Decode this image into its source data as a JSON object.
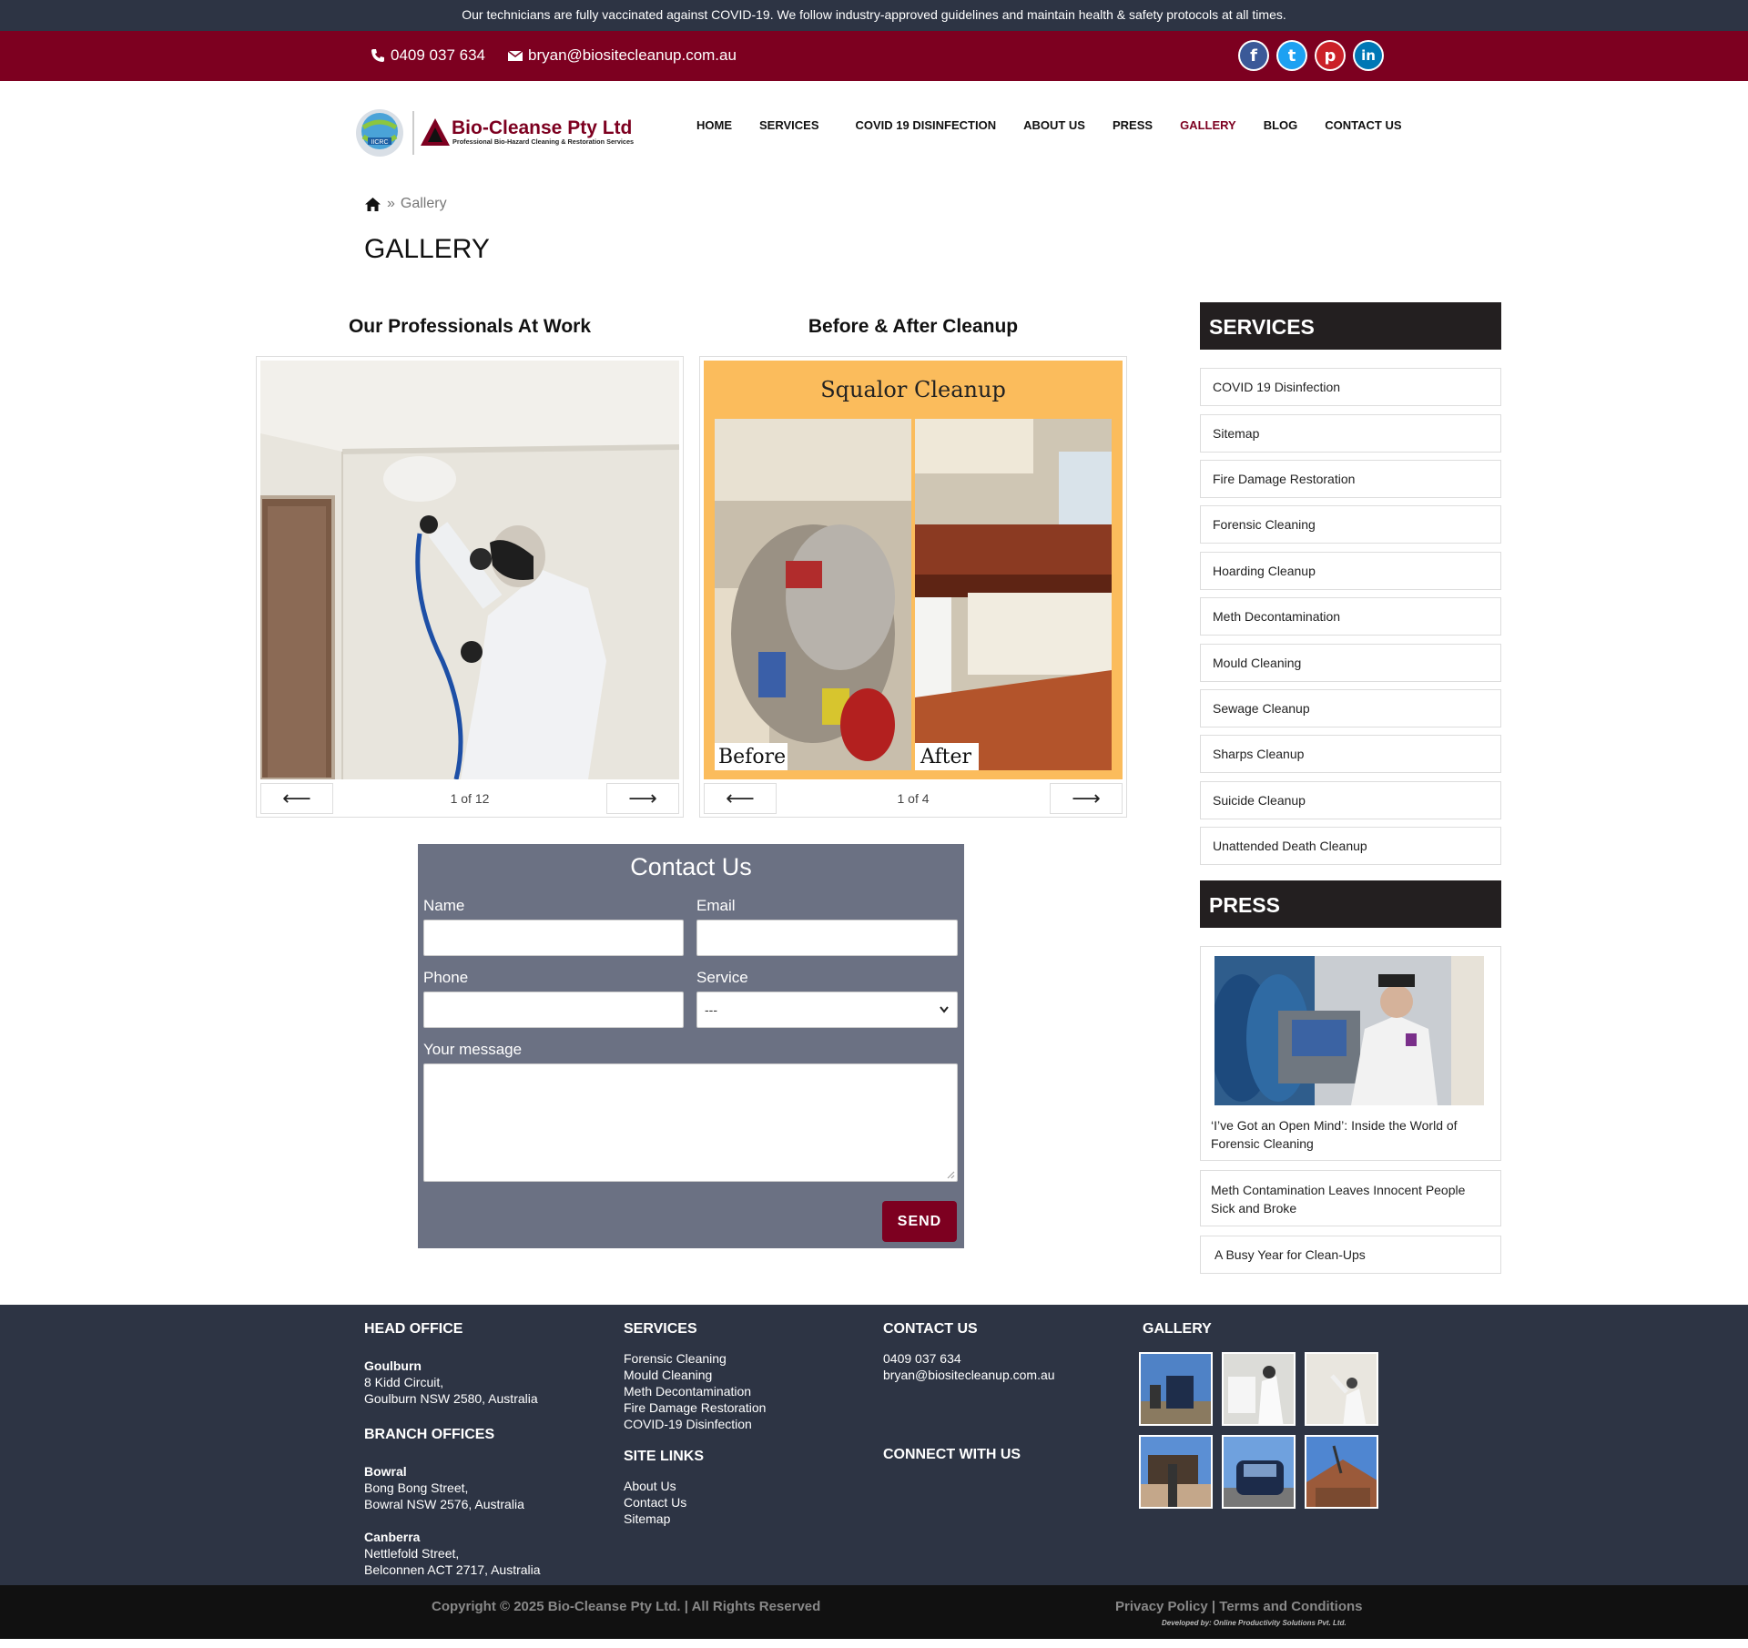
{
  "notice": "Our technicians are fully vaccinated against COVID-19. We follow industry-approved guidelines and maintain health & safety protocols at all times.",
  "contact_bar": {
    "phone": "0409 037 634",
    "email": "bryan@biositecleanup.com.au"
  },
  "socials": [
    {
      "name": "facebook-icon",
      "glyph": "f",
      "color": "#3b5998"
    },
    {
      "name": "twitter-icon",
      "glyph": "t",
      "color": "#1da1f2"
    },
    {
      "name": "pinterest-icon",
      "glyph": "p",
      "color": "#cb2027"
    },
    {
      "name": "linkedin-icon",
      "glyph": "in",
      "color": "#0077b5"
    }
  ],
  "logo": {
    "name": "Bio-Cleanse Pty Ltd",
    "tagline": "Professional Bio-Hazard Cleaning & Restoration Services",
    "badge": "IICRC"
  },
  "nav": [
    "HOME",
    "SERVICES",
    "COVID 19 DISINFECTION",
    "ABOUT US",
    "PRESS",
    "GALLERY",
    "BLOG",
    "CONTACT US"
  ],
  "breadcrumb": {
    "separator": "»",
    "current": "Gallery"
  },
  "page_title": "GALLERY",
  "galleries": [
    {
      "title": "Our Professionals At Work",
      "counter": "1 of 12",
      "prev": "⟵",
      "next": "⟶"
    },
    {
      "title": "Before & After Cleanup",
      "counter": "1 of 4",
      "prev": "⟵",
      "next": "⟶",
      "image_title": "Squalor Cleanup",
      "before_label": "Before",
      "after_label": "After"
    }
  ],
  "contact_form": {
    "title": "Contact Us",
    "name_label": "Name",
    "email_label": "Email",
    "phone_label": "Phone",
    "service_label": "Service",
    "service_value": "---",
    "message_label": "Your message",
    "send_label": "SEND"
  },
  "sidebar": {
    "services_title": "SERVICES",
    "services": [
      "COVID 19 Disinfection",
      "Sitemap",
      "Fire Damage Restoration",
      "Forensic Cleaning",
      "Hoarding Cleanup",
      "Meth Decontamination",
      "Mould Cleaning",
      "Sewage Cleanup",
      "Sharps Cleanup",
      "Suicide Cleanup",
      "Unattended Death Cleanup"
    ],
    "press_title": "PRESS",
    "press": [
      "‘I’ve Got an Open Mind’: Inside the World of Forensic Cleaning",
      "Meth Contamination Leaves Innocent People Sick and Broke",
      "A Busy Year for Clean-Ups"
    ]
  },
  "footer": {
    "head_office_title": "HEAD OFFICE",
    "head_office": {
      "city": "Goulburn",
      "line1": "8 Kidd Circuit,",
      "line2": "Goulburn NSW 2580, Australia"
    },
    "branch_title": "BRANCH OFFICES",
    "branches": [
      {
        "city": "Bowral",
        "line1": "Bong Bong Street,",
        "line2": "Bowral NSW 2576, Australia"
      },
      {
        "city": "Canberra",
        "line1": "Nettlefold Street,",
        "line2": "Belconnen ACT 2717, Australia"
      }
    ],
    "services_title": "SERVICES",
    "services": [
      "Forensic Cleaning",
      "Mould Cleaning",
      "Meth Decontamination",
      "Fire Damage Restoration",
      "COVID-19 Disinfection"
    ],
    "site_links_title": "SITE LINKS",
    "site_links": [
      "About Us",
      "Contact Us",
      "Sitemap"
    ],
    "contact_title": "CONTACT US",
    "phone": "0409 037 634",
    "email": "bryan@biositecleanup.com.au",
    "connect_title": "CONNECT WITH US",
    "gallery_title": "GALLERY"
  },
  "bottom": {
    "copyright": "Copyright © 2025 Bio-Cleanse Pty Ltd. | All Rights Reserved",
    "privacy": "Privacy Policy",
    "sep": "|",
    "terms": "Terms and Conditions",
    "developer": "Developed by: Online Productivity Solutions Pvt. Ltd."
  }
}
